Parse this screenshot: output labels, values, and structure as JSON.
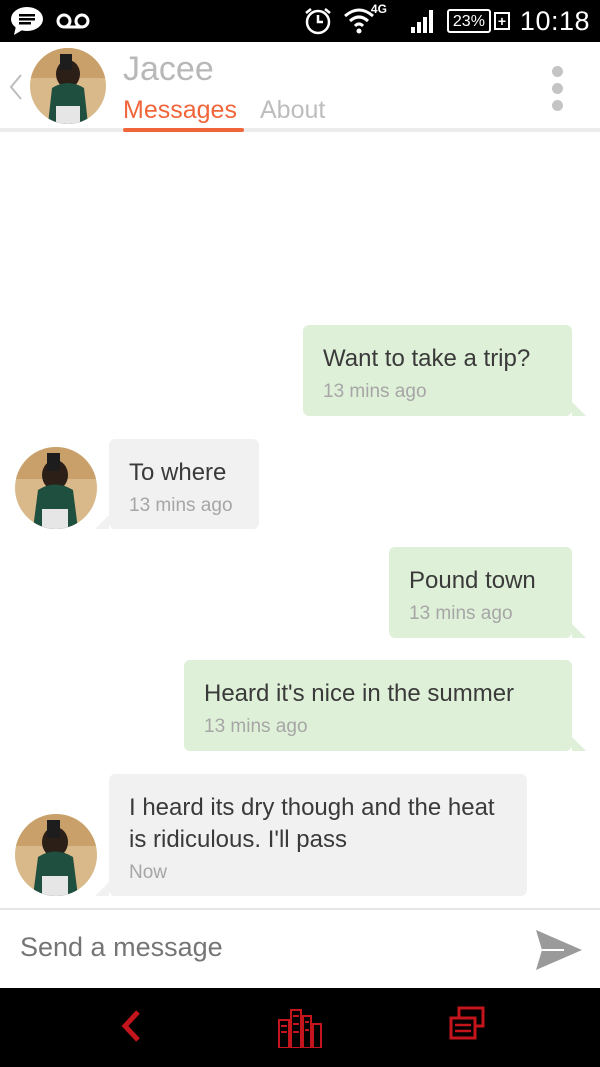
{
  "status_bar": {
    "time": "10:18",
    "battery": "23%",
    "network": "4G"
  },
  "header": {
    "name": "Jacee",
    "tabs": [
      {
        "label": "Messages",
        "active": true
      },
      {
        "label": "About",
        "active": false
      }
    ]
  },
  "messages": [
    {
      "direction": "out",
      "text": "Want to take a trip?",
      "time": "13 mins ago"
    },
    {
      "direction": "in",
      "text": "To where",
      "time": "13 mins ago"
    },
    {
      "direction": "out",
      "text": "Pound town",
      "time": "13 mins ago"
    },
    {
      "direction": "out",
      "text": "Heard it's nice in the summer",
      "time": "13 mins ago"
    },
    {
      "direction": "in",
      "text": "I heard its dry though and the heat is ridiculous. I'll pass",
      "time": "Now"
    }
  ],
  "composer": {
    "placeholder": "Send a message"
  },
  "colors": {
    "accent": "#f0653a",
    "outgoing_bubble": "#dff0d8",
    "incoming_bubble": "#f1f1f1",
    "nav_icons": "#c4141c"
  },
  "icons": {
    "status_left": [
      "chat-bubble-icon",
      "voicemail-icon"
    ],
    "status_right": [
      "alarm-icon",
      "wifi-icon",
      "signal-icon",
      "battery-icon"
    ],
    "nav": [
      "back-icon",
      "home-icon",
      "recent-apps-icon"
    ],
    "header_menu": "more-vert-icon",
    "composer_send": "send-icon"
  }
}
